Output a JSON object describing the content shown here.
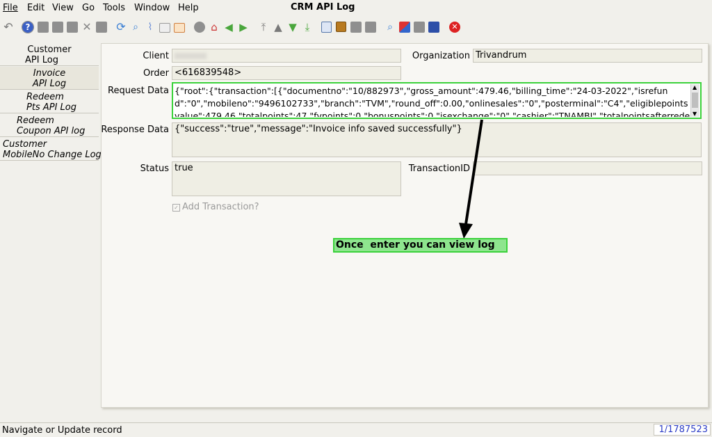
{
  "menu": [
    {
      "label": "File"
    },
    {
      "label": "Edit"
    },
    {
      "label": "View"
    },
    {
      "label": "Go"
    },
    {
      "label": "Tools"
    },
    {
      "label": "Window"
    },
    {
      "label": "Help"
    }
  ],
  "window_title": "CRM API Log",
  "toolbar_icons": [
    "undo-icon",
    "help-icon",
    "new-record-icon",
    "copy-record-icon",
    "delete-icon",
    "delete-selection-icon",
    "save-icon",
    "refresh-icon",
    "find-icon",
    "attachment-icon",
    "chat-icon",
    "grid-toggle-icon",
    "history-icon",
    "home-icon",
    "back-icon",
    "forward-icon",
    "first-record-icon",
    "previous-record-icon",
    "next-record-icon",
    "last-record-icon",
    "report-icon",
    "archive-icon",
    "print-preview-icon",
    "print-icon",
    "zoom-across-icon",
    "workflow-icon",
    "request-icon",
    "product-info-icon",
    "end-icon"
  ],
  "sidebar": {
    "items": [
      {
        "line1": "Customer",
        "line2": "API Log",
        "italic": false
      },
      {
        "line1": "Invoice",
        "line2": "API Log",
        "italic": true
      },
      {
        "line1": "Redeem",
        "line2": "Pts API Log",
        "italic": true
      },
      {
        "line1": "Redeem",
        "line2": "Coupon API log",
        "italic": true
      },
      {
        "line1": "Customer",
        "line2": "MobileNo Change Log",
        "italic": true
      }
    ]
  },
  "form": {
    "client_label": "Client",
    "client_value": "",
    "organization_label": "Organization",
    "organization_value": "Trivandrum",
    "order_label": "Order",
    "order_value": "<616839548>",
    "request_label": "Request Data",
    "request_value": "{\"root\":{\"transaction\":[{\"documentno\":\"10/882973\",\"gross_amount\":479.46,\"billing_time\":\"24-03-2022\",\"isrefund\":\"0\",\"mobileno\":\"9496102733\",\"branch\":\"TVM\",\"round_off\":0.00,\"onlinesales\":\"0\",\"posterminal\":\"C4\",\"eligiblepointsvalue\":479.46,\"totalpoints\":47,\"fvpoints\":0,\"bonuspoints\":0,\"isexchange\":\"0\",\"cashier\":\"TNAMBI\",\"totalpointsafterrede",
    "response_label": "Response Data",
    "response_value": "{\"success\":\"true\",\"message\":\"Invoice info saved successfully\"}",
    "status_label": "Status",
    "status_value": "true",
    "transaction_label": "TransactionID",
    "transaction_value": "",
    "add_transaction_label": "Add Transaction?"
  },
  "annotation": {
    "text": "Once  enter you can view log"
  },
  "status_bar": {
    "message": "Navigate or Update record",
    "record": "1/1787523"
  },
  "colors": {
    "highlight_border": "#3bd23b",
    "callout_bg": "#8ee58e",
    "record_text": "#2b3cc5"
  }
}
